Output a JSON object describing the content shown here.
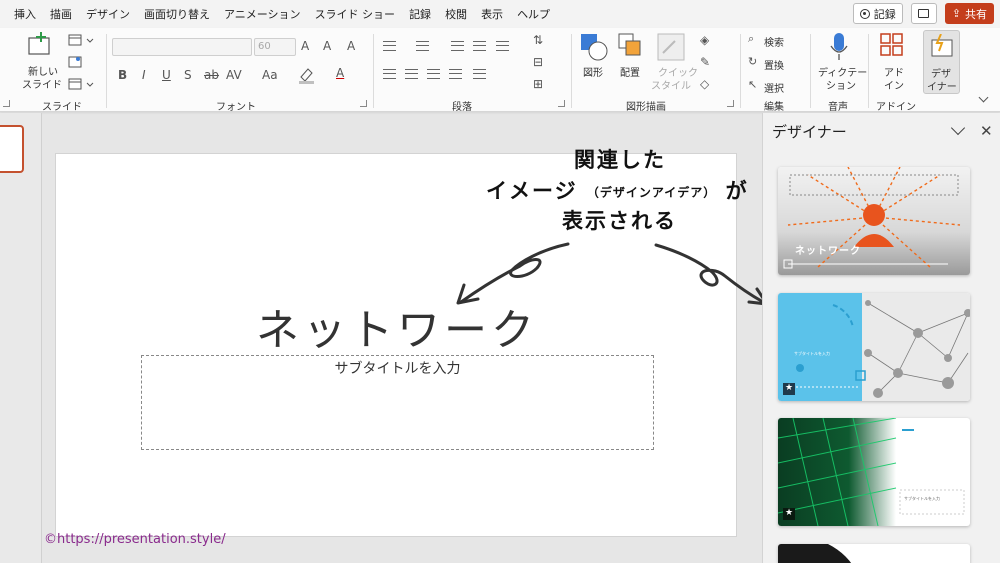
{
  "menu": [
    "挿入",
    "描画",
    "デザイン",
    "画面切り替え",
    "アニメーション",
    "スライド ショー",
    "記録",
    "校閲",
    "表示",
    "ヘルプ"
  ],
  "top_buttons": {
    "record": "記録",
    "share": "共有"
  },
  "ribbon": {
    "new_slide": [
      "新しい",
      "スライド"
    ],
    "font_size": "60",
    "font_buttons": [
      "B",
      "I",
      "U",
      "S",
      "ab",
      "AV",
      "Aa",
      "A"
    ],
    "shape": "図形",
    "arrange": "配置",
    "quick_style": [
      "クイック",
      "スタイル"
    ],
    "search": "検索",
    "replace": "置換",
    "select": "選択",
    "dictation": [
      "ディクテー",
      "ション"
    ],
    "addin": [
      "アド",
      "イン"
    ],
    "designer": [
      "デザ",
      "イナー"
    ],
    "groups": {
      "slide": "スライド",
      "font": "フォント",
      "paragraph": "段落",
      "drawing": "図形描画",
      "editing": "編集",
      "voice": "音声",
      "addins": "アドイン"
    }
  },
  "slide": {
    "title": "ネットワーク",
    "subtitle": "サブタイトルを入力"
  },
  "annotation": {
    "line1": "関連した",
    "line2_big": "イメージ",
    "line2_small": "（デザインアイデア）",
    "line2_tail": "が",
    "line3": "表示される"
  },
  "copyright": "©https://presentation.style/",
  "designer": {
    "title": "デザイナー",
    "card1_text": "ネットワーク",
    "card2_text": "サブタイトルを入力",
    "card3_text": "サブタイトルを入力"
  },
  "colors": {
    "accent": "#c43e1c",
    "designer_blue": "#5bc2ea",
    "green": "#18c96a",
    "signature": "#8a2b8d"
  }
}
